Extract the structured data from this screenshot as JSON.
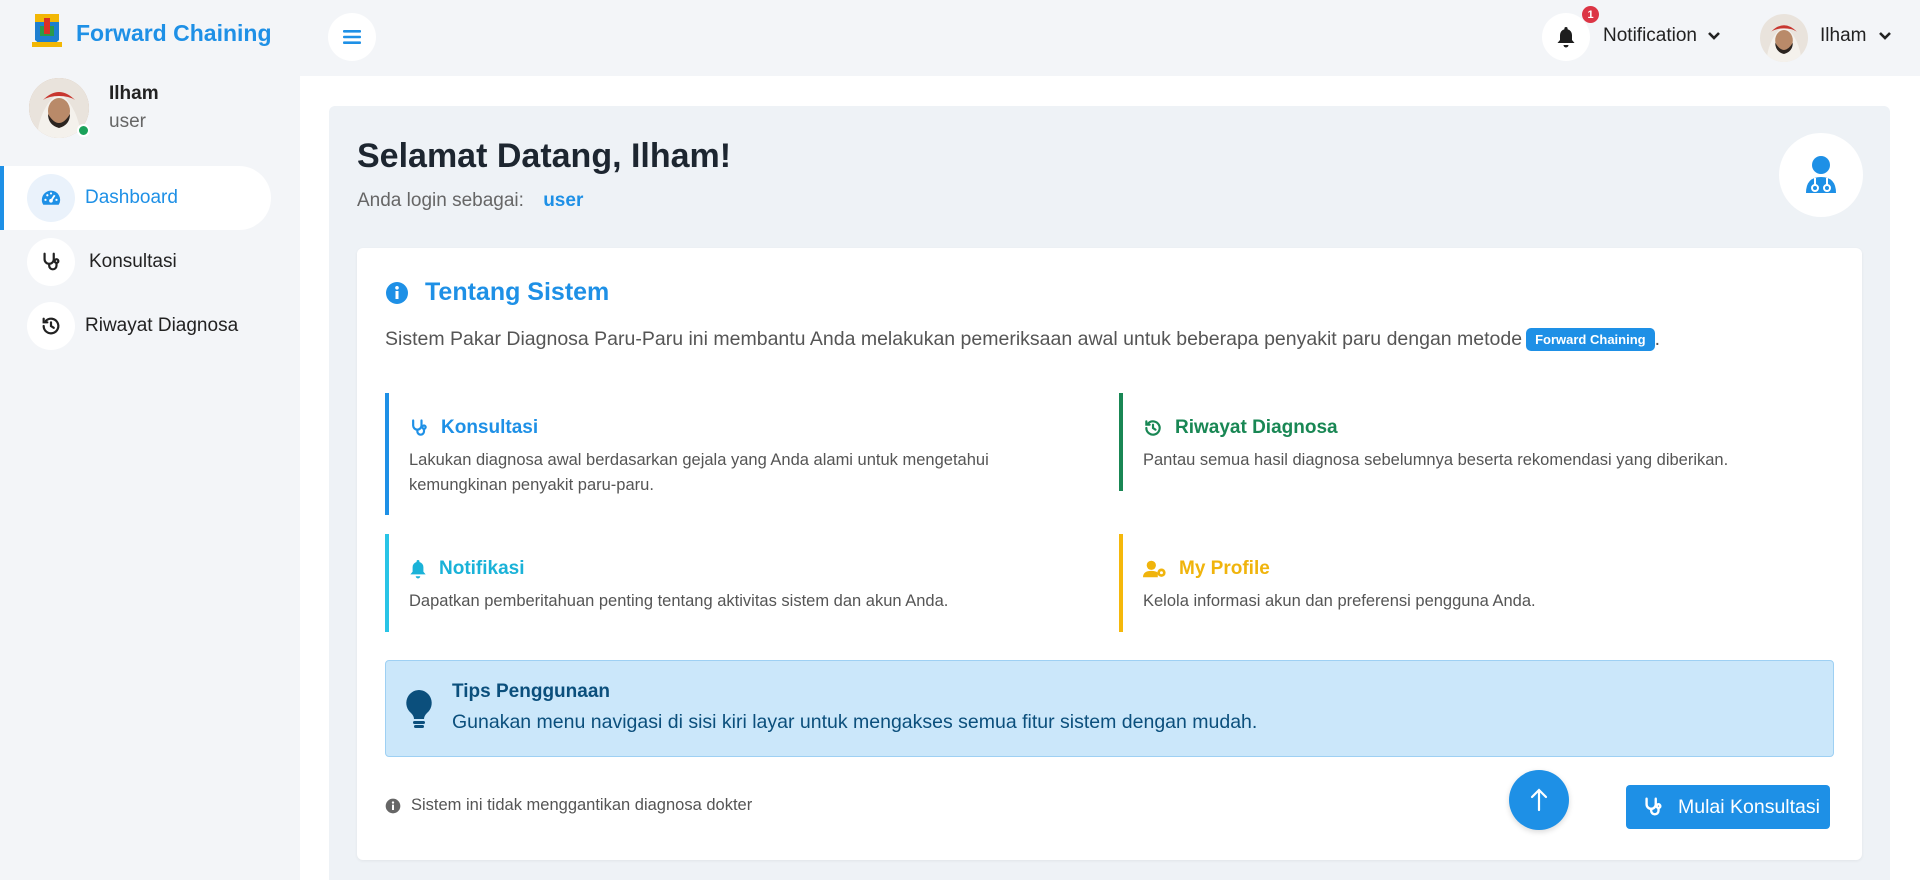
{
  "brand": {
    "title": "Forward Chaining",
    "logo_icon": "crest-logo"
  },
  "sidebar": {
    "user": {
      "name": "Ilham",
      "role": "user",
      "status": "online"
    },
    "items": [
      {
        "label": "Dashboard",
        "icon": "gauge-icon",
        "active": true
      },
      {
        "label": "Konsultasi",
        "icon": "stethoscope-icon",
        "active": false
      },
      {
        "label": "Riwayat Diagnosa",
        "icon": "history-icon",
        "active": false
      }
    ]
  },
  "topbar": {
    "menu_icon": "hamburger-icon",
    "notification": {
      "label": "Notification",
      "count": "1"
    },
    "user_name": "Ilham"
  },
  "welcome": {
    "title": "Selamat Datang, Ilham!",
    "login_prefix": "Anda login sebagai:",
    "login_role": "user"
  },
  "about": {
    "title": "Tentang Sistem",
    "description": "Sistem Pakar Diagnosa Paru-Paru ini membantu Anda melakukan pemeriksaan awal untuk beberapa penyakit paru dengan metode",
    "method_badge": "Forward Chaining",
    "description_end": "."
  },
  "features": [
    {
      "title": "Konsultasi",
      "text": "Lakukan diagnosa awal berdasarkan gejala yang Anda alami untuk mengetahui kemungkinan penyakit paru-paru.",
      "color": "#1e90e6"
    },
    {
      "title": "Riwayat Diagnosa",
      "text": "Pantau semua hasil diagnosa sebelumnya beserta rekomendasi yang diberikan.",
      "color": "#198754"
    },
    {
      "title": "Notifikasi",
      "text": "Dapatkan pemberitahuan penting tentang aktivitas sistem dan akun Anda.",
      "color": "#29c4e6"
    },
    {
      "title": "My Profile",
      "text": "Kelola informasi akun dan preferensi pengguna Anda.",
      "color": "#f5b80b"
    }
  ],
  "tips": {
    "title": "Tips Penggunaan",
    "text": "Gunakan menu navigasi di sisi kiri layar untuk mengakses semua fitur sistem dengan mudah."
  },
  "disclaimer": "Sistem ini tidak menggantikan diagnosa dokter",
  "cta_label": "Mulai Konsultasi",
  "colors": {
    "primary": "#1e90e6",
    "success": "#198754",
    "info": "#29c4e6",
    "warning": "#f5b80b",
    "danger": "#dc3545"
  }
}
